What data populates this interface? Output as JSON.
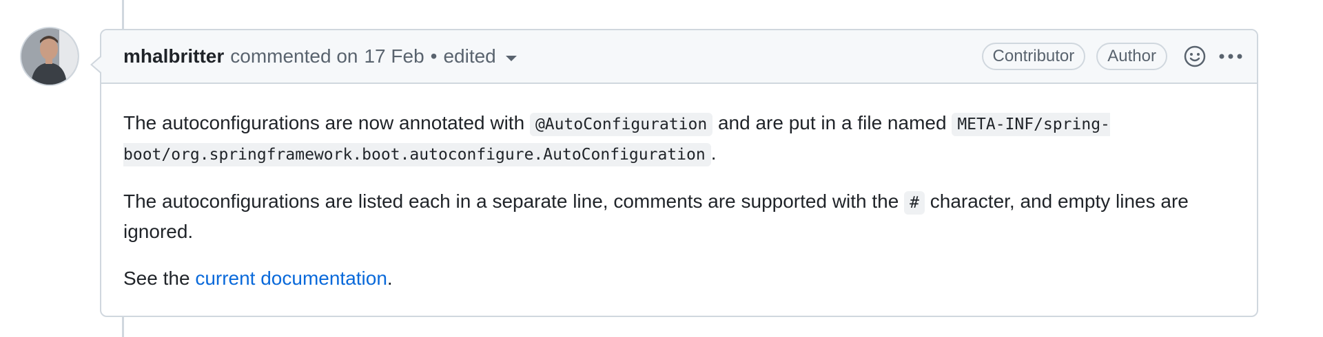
{
  "comment": {
    "author": "mhalbritter",
    "action": "commented on",
    "date": "17 Feb",
    "separator": "•",
    "edited_label": "edited",
    "labels": {
      "contributor": "Contributor",
      "author": "Author"
    },
    "icons": [
      "smiley-icon",
      "kebab-horizontal-icon",
      "triangle-down-icon"
    ],
    "body": {
      "p1_text1": "The autoconfigurations are now annotated with ",
      "p1_code1": "@AutoConfiguration",
      "p1_text2": " and are put in a file named ",
      "p1_code2": "META-INF/spring-boot/org.springframework.boot.autoconfigure.AutoConfiguration",
      "p1_text3": ".",
      "p2_text1": "The autoconfigurations are listed each in a separate line, comments are supported with the ",
      "p2_code1": "#",
      "p2_text2": " character, and empty lines are ignored.",
      "p3_text1": "See the ",
      "p3_link": "current documentation",
      "p3_text2": "."
    }
  },
  "colors": {
    "link": "#0969da",
    "border": "#d0d7de",
    "header_bg": "#f6f8fa",
    "muted": "#59636e"
  }
}
